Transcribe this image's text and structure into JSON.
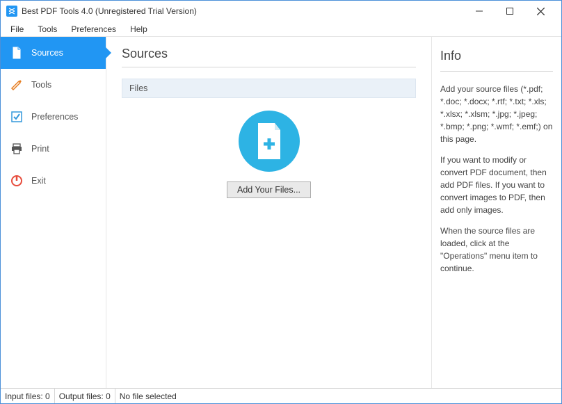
{
  "window": {
    "title": "Best PDF Tools 4.0 (Unregistered Trial Version)"
  },
  "menubar": {
    "file": "File",
    "tools": "Tools",
    "preferences": "Preferences",
    "help": "Help"
  },
  "sidebar": {
    "sources": "Sources",
    "tools": "Tools",
    "preferences": "Preferences",
    "print": "Print",
    "exit": "Exit"
  },
  "center": {
    "heading": "Sources",
    "files_label": "Files",
    "add_button": "Add Your Files..."
  },
  "info": {
    "heading": "Info",
    "p1": "Add your source files (*.pdf; *.doc; *.docx; *.rtf; *.txt; *.xls; *.xlsx; *.xlsm; *.jpg; *.jpeg; *.bmp; *.png; *.wmf; *.emf;) on this page.",
    "p2": "If you want to modify or convert PDF document, then add PDF files. If you want to convert images to PDF, then add only images.",
    "p3": "When the source files are loaded, click at the \"Operations\" menu item to continue."
  },
  "statusbar": {
    "input": "Input files: 0",
    "output": "Output files: 0",
    "selection": "No file selected"
  }
}
